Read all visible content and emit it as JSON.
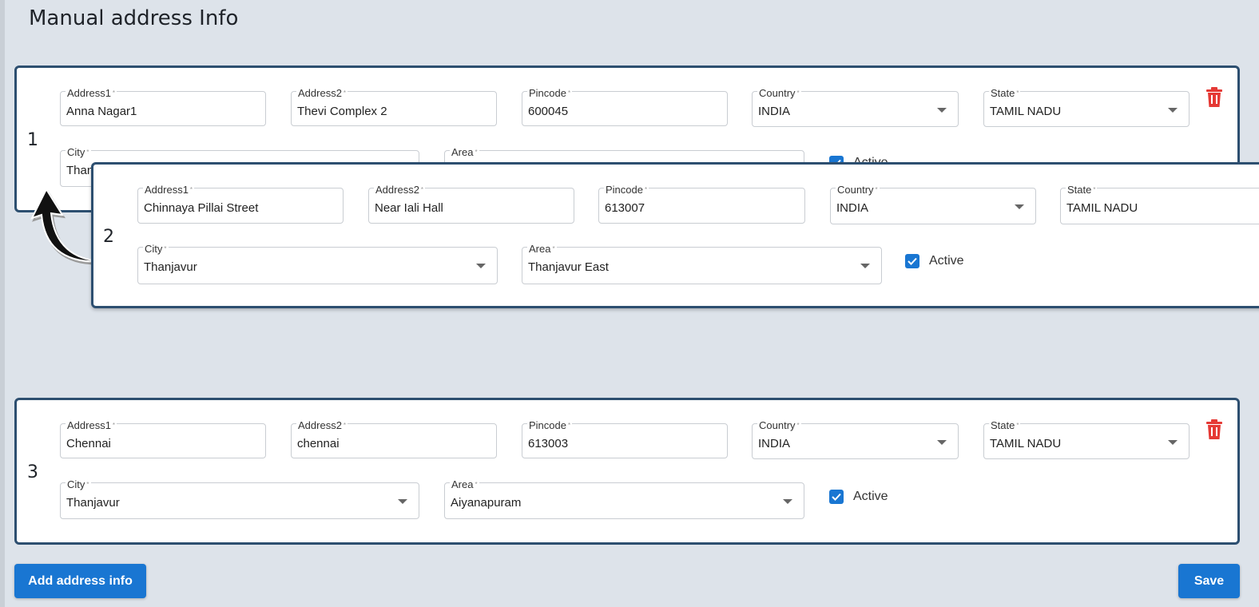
{
  "page": {
    "title": "Manual address Info"
  },
  "labels": {
    "address1": "Address1",
    "address2": "Address2",
    "pincode": "Pincode",
    "country": "Country",
    "state": "State",
    "city": "City",
    "area": "Area",
    "required_mark": "*",
    "active": "Active"
  },
  "cards": [
    {
      "number": "1",
      "address1": "Anna Nagar1",
      "address2": "Thevi Complex 2",
      "pincode": "600045",
      "country": "INDIA",
      "state": "TAMIL NADU",
      "city": "Than",
      "area": "",
      "active_label": "Active"
    },
    {
      "number": "2",
      "address1": "Chinnaya Pillai Street",
      "address2": "Near Iali Hall",
      "pincode": "613007",
      "country": "INDIA",
      "state": "TAMIL NADU",
      "city": "Thanjavur",
      "area": "Thanjavur East",
      "active_label": "Active"
    },
    {
      "number": "3",
      "address1": "Chennai",
      "address2": "chennai",
      "pincode": "613003",
      "country": "INDIA",
      "state": "TAMIL NADU",
      "city": "Thanjavur",
      "area": "Aiyanapuram",
      "active_label": "Active"
    }
  ],
  "buttons": {
    "add": "Add address info",
    "save": "Save"
  },
  "icons": {
    "delete": "trash-icon",
    "checkbox": "check-icon",
    "drag_arrow": "curved-arrow-icon",
    "dropdown": "caret-down-icon"
  },
  "colors": {
    "primary": "#1976d2",
    "card_border": "#2d4f70",
    "delete": "#e53935",
    "background": "#dde3ea"
  }
}
